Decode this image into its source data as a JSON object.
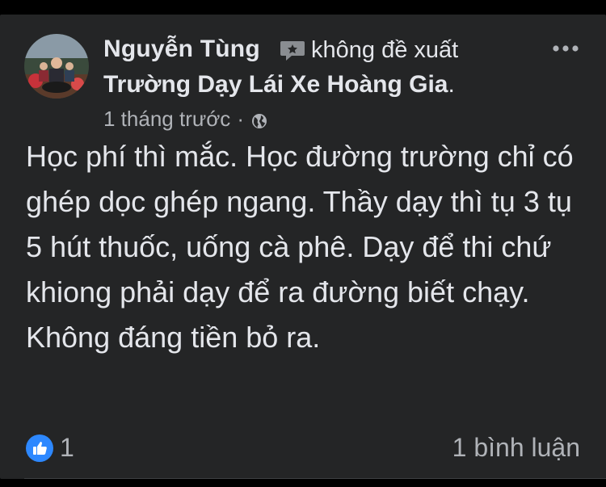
{
  "review": {
    "author_name": "Nguyễn Tùng",
    "recommendation_icon": "speech-bubble-not-recommend-icon",
    "recommendation_text": "không đề xuất",
    "page_name": "Trường Dạy Lái Xe Hoàng Gia",
    "page_suffix": ".",
    "timestamp": "1 tháng trước",
    "separator": "·",
    "privacy_icon": "globe-icon",
    "more_icon": "more-options-icon",
    "body": "Học phí thì mắc. Học đường trường chỉ có ghép dọc ghép ngang. Thầy dạy thì tụ 3 tụ 5 hút thuốc, uống cà phê. Dạy để thi chứ khiong phải dạy để ra đường biết chạy. Không đáng tiền bỏ ra."
  },
  "footer": {
    "like_icon": "thumbs-up-icon",
    "like_count": "1",
    "comment_count_text": "1 bình luận"
  },
  "colors": {
    "background": "#000000",
    "card": "#242526",
    "primary_text": "#e4e6eb",
    "secondary_text": "#b0b3b8",
    "like_blue": "#2d88ff"
  }
}
